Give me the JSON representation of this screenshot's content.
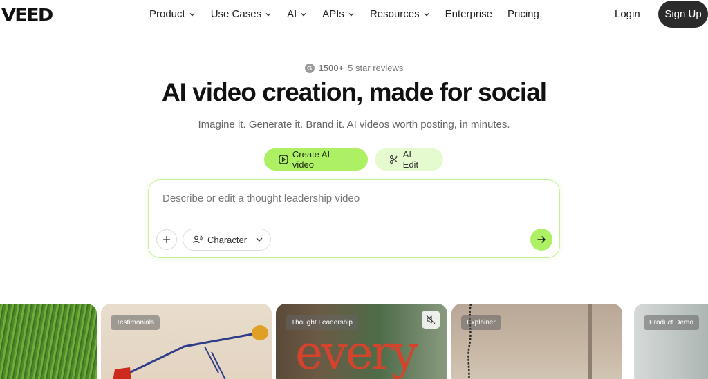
{
  "nav": {
    "logo": "VEED",
    "menu": [
      "Product",
      "Use Cases",
      "AI",
      "APIs",
      "Resources",
      "Enterprise",
      "Pricing"
    ],
    "login": "Login",
    "signup": "Sign Up"
  },
  "hero": {
    "rating_count": "1500+",
    "rating_text": "5 star reviews",
    "headline": "AI video creation, made for social",
    "subtitle": "Imagine it. Generate it. Brand it. AI videos worth posting, in minutes.",
    "modes": [
      "Create AI video",
      "AI Edit"
    ],
    "prompt_placeholder": "Describe or edit a thought leadership video",
    "character_label": "Character"
  },
  "cards": {
    "labels": [
      "Testimonials",
      "Thought Leadership",
      "Explainer",
      "Product Demo"
    ],
    "card3_overlay_text": "every"
  },
  "colors": {
    "accent": "#aef064",
    "accent_light": "#e6fad0",
    "dark_button": "#2b2b2b"
  }
}
